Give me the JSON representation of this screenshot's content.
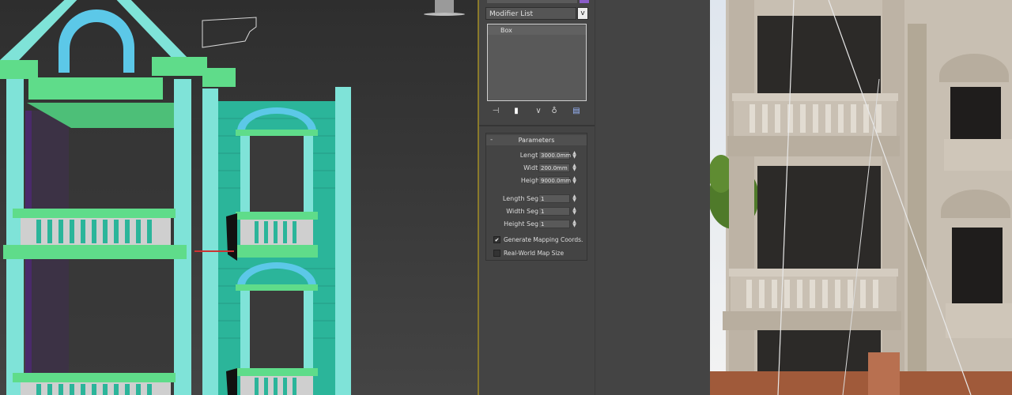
{
  "modifier_panel": {
    "modifier_list_label": "Modifier List",
    "modifier_dropdown_arrow": "v",
    "stack_items": [
      "Box"
    ],
    "stack_tools": [
      "pin-stack-icon",
      "show-end-result-icon",
      "make-unique-icon",
      "remove-modifier-icon",
      "configure-modifier-sets-icon"
    ]
  },
  "parameters": {
    "title": "Parameters",
    "collapse_symbol": "-",
    "rows": [
      {
        "label": "Length:",
        "value": "3000.0mm"
      },
      {
        "label": "Width:",
        "value": "200.0mm"
      },
      {
        "label": "Height:",
        "value": "9000.0mm"
      },
      {
        "label": "Length Segs:",
        "value": "1"
      },
      {
        "label": "Width Segs:",
        "value": "1"
      },
      {
        "label": "Height Segs:",
        "value": "1"
      }
    ],
    "generate_mapping_coords": {
      "label": "Generate Mapping Coords.",
      "checked": true,
      "mark": "✔"
    },
    "real_world_map_size": {
      "label": "Real-World Map Size",
      "checked": false
    }
  },
  "colors": {
    "panel_bg": "#444444",
    "viewport_bg": "#3a3a3a",
    "object_color": "#8a5cc8",
    "model_cyan": "#7fe3d8",
    "model_green": "#5fdc8a",
    "model_teal": "#2bb59a"
  }
}
